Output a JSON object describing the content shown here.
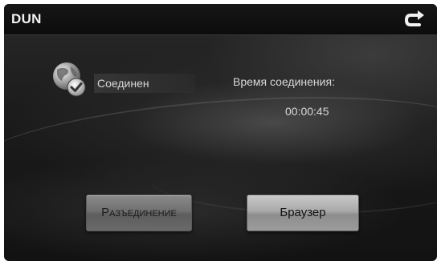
{
  "header": {
    "title": "DUN",
    "back_icon": "back-arrow-icon"
  },
  "connection": {
    "status": "Соединен",
    "time_caption": "Время соединения:",
    "time_value": "00:00:45",
    "status_icon": "globe-check-icon"
  },
  "buttons": {
    "disconnect": "Разъединение",
    "browser": "Браузер"
  },
  "colors": {
    "background": "#1c1c1c",
    "text": "#d8d8d8",
    "button": "#a8a8a8"
  }
}
